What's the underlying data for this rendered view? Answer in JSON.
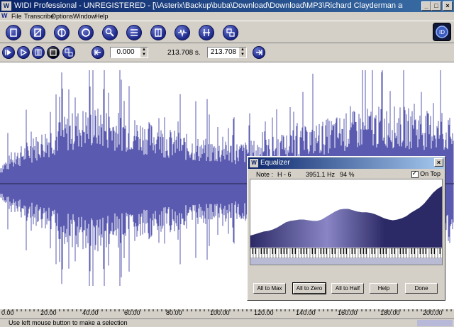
{
  "window": {
    "title": "WIDI Professional - UNREGISTERED - [\\\\Asterix\\Backup\\buba\\Download\\Download\\MP3\\Richard Clayderman and J. Last - izbor\\R. Clayderman and J....",
    "app_icon_label": "W"
  },
  "menu": [
    "File",
    "Transcribe",
    "Options",
    "Window",
    "Help"
  ],
  "toolbar": {
    "tools": [
      "open-file",
      "no-file",
      "split",
      "circle",
      "search",
      "list",
      "stop-box",
      "waveform",
      "bars",
      "convert"
    ]
  },
  "transport": {
    "start_value": "0.000",
    "duration_text": "213.708 s.",
    "end_value": "213.708"
  },
  "ruler": {
    "ticks": [
      "0.00",
      "20.00",
      "40.00",
      "60.00",
      "80.00",
      "100.00",
      "120.00",
      "140.00",
      "160.00",
      "180.00",
      "200.00"
    ]
  },
  "status": {
    "text": "Use left mouse button to make a selection"
  },
  "equalizer": {
    "title": "Equalizer",
    "note_label": "Note :",
    "note_value": "H  - 6",
    "frequency": "3951.1 Hz",
    "percent": "94 %",
    "on_top_label": "On Top",
    "on_top_checked": true,
    "buttons": [
      "All to Max",
      "All to Zero",
      "All to Half",
      "Help",
      "Done"
    ],
    "curve_levels": [
      0.18,
      0.2,
      0.22,
      0.24,
      0.25,
      0.27,
      0.3,
      0.34,
      0.38,
      0.4,
      0.41,
      0.42,
      0.42,
      0.41,
      0.4,
      0.4,
      0.42,
      0.46,
      0.5,
      0.54,
      0.57,
      0.58,
      0.58,
      0.56,
      0.54,
      0.53,
      0.53,
      0.52,
      0.5,
      0.47,
      0.44,
      0.42,
      0.41,
      0.42,
      0.44,
      0.47,
      0.52,
      0.56,
      0.6,
      0.66,
      0.74,
      0.82,
      0.88,
      0.92
    ]
  },
  "colors": {
    "wave": "#5a5ab0",
    "eq_fill_dark": "#2c2a66",
    "eq_fill_light": "#8a86c6",
    "title_bar": "#0a246a"
  }
}
